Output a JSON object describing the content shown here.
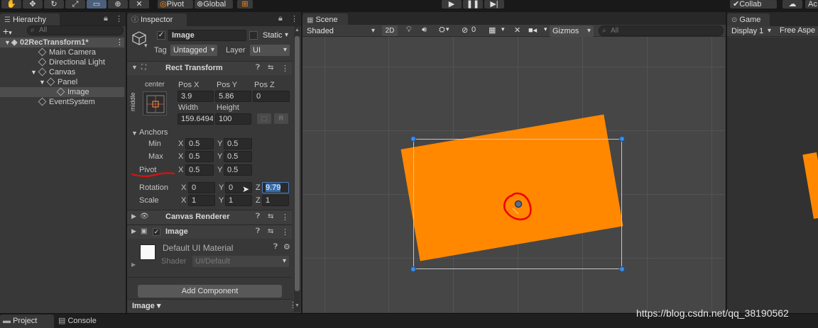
{
  "toolbar": {
    "pivot_label": "Pivot",
    "global_label": "Global",
    "collab_label": "Collab",
    "account_label": "Ac"
  },
  "hierarchy": {
    "tab": "Hierarchy",
    "search_placeholder": "All",
    "scene_name": "02RecTransform1*",
    "items": [
      {
        "label": "Main Camera"
      },
      {
        "label": "Directional Light"
      },
      {
        "label": "Canvas"
      },
      {
        "label": "Panel"
      },
      {
        "label": "Image"
      },
      {
        "label": "EventSystem"
      }
    ]
  },
  "inspector": {
    "tab": "Inspector",
    "object_name": "Image",
    "static_label": "Static",
    "tag_label": "Tag",
    "tag_value": "Untagged",
    "layer_label": "Layer",
    "layer_value": "UI",
    "rect_transform": {
      "title": "Rect Transform",
      "anchor_h": "center",
      "anchor_v": "middle",
      "pos_x_label": "Pos X",
      "pos_x": "3.9",
      "pos_y_label": "Pos Y",
      "pos_y": "5.86",
      "pos_z_label": "Pos Z",
      "pos_z": "0",
      "width_label": "Width",
      "width": "159.6494",
      "height_label": "Height",
      "height": "100",
      "anchors_label": "Anchors",
      "min_label": "Min",
      "min_x": "0.5",
      "min_y": "0.5",
      "max_label": "Max",
      "max_x": "0.5",
      "max_y": "0.5",
      "pivot_label": "Pivot",
      "pivot_x": "0.5",
      "pivot_y": "0.5",
      "rotation_label": "Rotation",
      "rot_x": "0",
      "rot_y": "0",
      "rot_z": "9.79",
      "scale_label": "Scale",
      "scale_x": "1",
      "scale_y": "1",
      "scale_z": "1",
      "x": "X",
      "y": "Y",
      "z": "Z",
      "r_button": "R"
    },
    "canvas_renderer": "Canvas Renderer",
    "image_component": "Image",
    "material_name": "Default UI Material",
    "shader_label": "Shader",
    "shader_value": "UI/Default",
    "add_component": "Add Component",
    "footer_label": "Image"
  },
  "scene": {
    "tab": "Scene",
    "shading": "Shaded",
    "mode_2d": "2D",
    "hidden_count": "0",
    "gizmos": "Gizmos",
    "search_placeholder": "All",
    "object_color": "#ff8800",
    "selection_color": "#c7c7c7",
    "handle_color": "#3d8be4",
    "annotation_color": "#ff0000"
  },
  "game": {
    "tab": "Game",
    "display": "Display 1",
    "aspect": "Free Aspe"
  },
  "status": {
    "project_tab": "Project",
    "console_tab": "Console",
    "watermark": "https://blog.csdn.net/qq_38190562"
  }
}
